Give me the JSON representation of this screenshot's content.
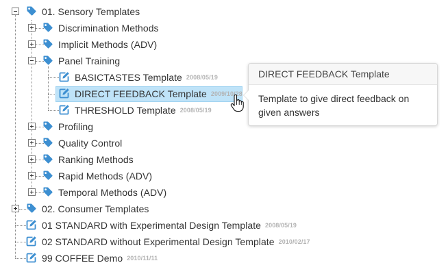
{
  "tree": {
    "sensory": {
      "label": "01. Sensory Templates",
      "icon": "tag-icon"
    },
    "discrimination": {
      "label": "Discrimination Methods",
      "icon": "tag-icon"
    },
    "implicit": {
      "label": "Implicit Methods (ADV)",
      "icon": "tag-icon"
    },
    "panel": {
      "label": "Panel Training",
      "icon": "tag-icon"
    },
    "basictastes": {
      "label": "BASICTASTES Template",
      "date": "2008/05/19",
      "icon": "edit-icon"
    },
    "direct": {
      "label": "DIRECT FEEDBACK Template",
      "date": "2009/10/28",
      "icon": "edit-icon"
    },
    "threshold": {
      "label": "THRESHOLD Template",
      "date": "2008/05/19",
      "icon": "edit-icon"
    },
    "profiling": {
      "label": "Profiling",
      "icon": "tag-icon"
    },
    "quality": {
      "label": "Quality Control",
      "icon": "tag-icon"
    },
    "ranking": {
      "label": "Ranking Methods",
      "icon": "tag-icon"
    },
    "rapid": {
      "label": "Rapid Methods (ADV)",
      "icon": "tag-icon"
    },
    "temporal": {
      "label": "Temporal Methods (ADV)",
      "icon": "tag-icon"
    },
    "consumer": {
      "label": "02. Consumer Templates",
      "icon": "tag-icon"
    },
    "standard_exp": {
      "label": "01 STANDARD with Experimental Design Template",
      "date": "2008/05/19",
      "icon": "edit-icon"
    },
    "standard_noexp": {
      "label": "02 STANDARD without Experimental Design Template",
      "date": "2010/02/17",
      "icon": "edit-icon"
    },
    "coffee": {
      "label": "99 COFFEE Demo",
      "date": "2010/11/11",
      "icon": "edit-icon"
    }
  },
  "tooltip": {
    "title": "DIRECT FEEDBACK Template",
    "body": "Template to give direct feedback on given answers"
  },
  "colors": {
    "icon_blue": "#3d8fd1",
    "selected_bg": "#bfe3f8",
    "date_gray": "#b3b3b3"
  }
}
